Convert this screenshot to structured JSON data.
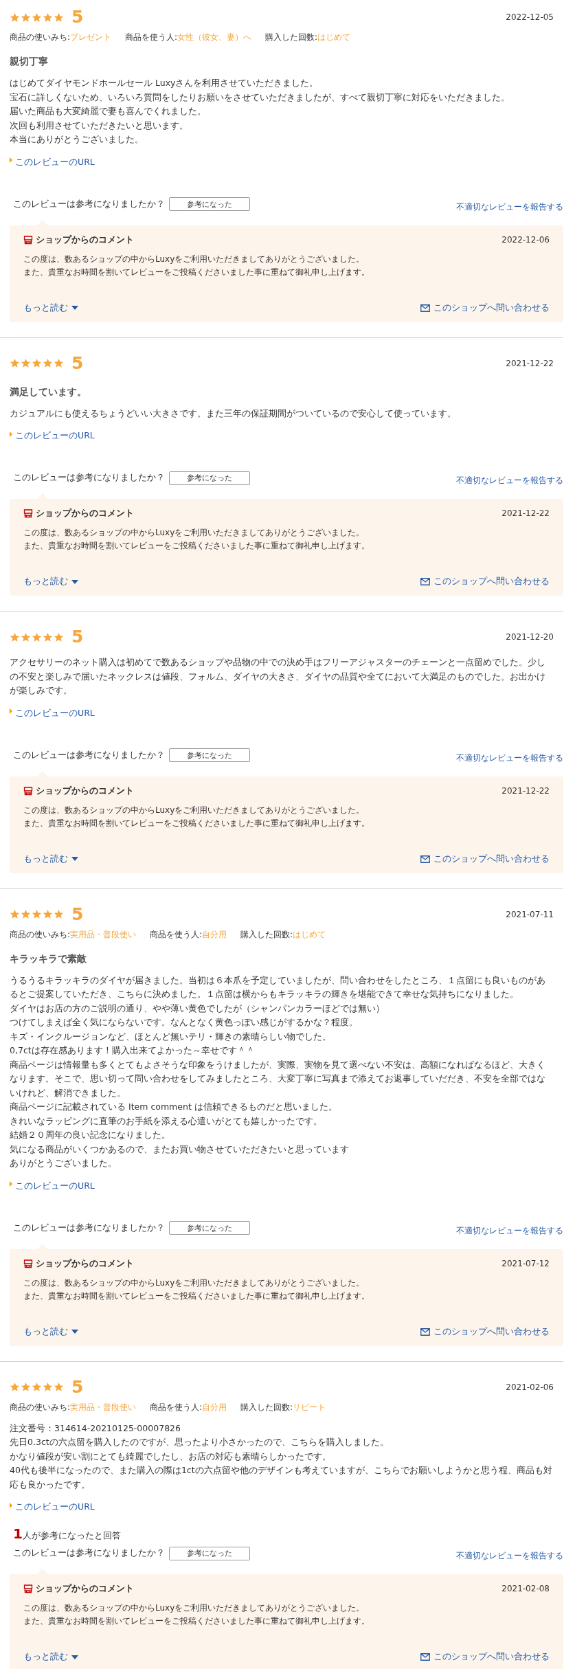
{
  "reviews": [
    {
      "stars": 5,
      "score": "5",
      "date": "2022-12-05",
      "meta": [
        {
          "label": "商品の使いみち:",
          "value": "プレゼント"
        },
        {
          "label": "商品を使う人:",
          "value": "女性（彼女、妻）へ"
        },
        {
          "label": "購入した回数:",
          "value": "はじめて"
        }
      ],
      "title": "親切丁寧",
      "body": [
        "はじめてダイヤモンドホールセール Luxyさんを利用させていただきました。",
        "宝石に詳しくないため、いろいろ質問をしたりお願いをさせていただきましたが、すべて親切丁寧に対応をいただきました。",
        "届いた商品も大変綺麗で妻も喜んでくれました。",
        "次回も利用させていただきたいと思います。",
        "本当にありがとうございました。"
      ],
      "url_link": "このレビューのURL",
      "question": "このレビューは参考になりましたか？",
      "helpful_button": "参考になった",
      "report_link": "不適切なレビューを報告する",
      "shop_comment": {
        "title": "ショップからのコメント",
        "date": "2022-12-06",
        "lines": [
          "この度は、数あるショップの中からLuxyをご利用いただきましてありがとうございました。",
          "また、貴重なお時間を割いてレビューをご投稿くださいました事に重ねて御礼申し上げます。"
        ],
        "more_link": "もっと読む",
        "contact_link": "このショップへ問い合わせる"
      }
    },
    {
      "stars": 5,
      "score": "5",
      "date": "2021-12-22",
      "title": "満足しています。",
      "body": [
        "カジュアルにも使えるちょうどいい大きさです。また三年の保証期間がついているので安心して使っています。"
      ],
      "url_link": "このレビューのURL",
      "question": "このレビューは参考になりましたか？",
      "helpful_button": "参考になった",
      "report_link": "不適切なレビューを報告する",
      "shop_comment": {
        "title": "ショップからのコメント",
        "date": "2021-12-22",
        "lines": [
          "この度は、数あるショップの中からLuxyをご利用いただきましてありがとうございました。",
          "また、貴重なお時間を割いてレビューをご投稿くださいました事に重ねて御礼申し上げます。"
        ],
        "more_link": "もっと読む",
        "contact_link": "このショップへ問い合わせる"
      }
    },
    {
      "stars": 5,
      "score": "5",
      "date": "2021-12-20",
      "body": [
        "アクセサリーのネット購入は初めてで数あるショップや品物の中での決め手はフリーアジャスターのチェーンと一点留めでした。少しの不安と楽しみで届いたネックレスは値段、フォルム、ダイヤの大きさ、ダイヤの品質や全てにおいて大満足のものでした。お出かけが楽しみです。"
      ],
      "url_link": "このレビューのURL",
      "question": "このレビューは参考になりましたか？",
      "helpful_button": "参考になった",
      "report_link": "不適切なレビューを報告する",
      "shop_comment": {
        "title": "ショップからのコメント",
        "date": "2021-12-22",
        "lines": [
          "この度は、数あるショップの中からLuxyをご利用いただきましてありがとうございました。",
          "また、貴重なお時間を割いてレビューをご投稿くださいました事に重ねて御礼申し上げます。"
        ],
        "more_link": "もっと読む",
        "contact_link": "このショップへ問い合わせる"
      }
    },
    {
      "stars": 5,
      "score": "5",
      "date": "2021-07-11",
      "meta": [
        {
          "label": "商品の使いみち:",
          "value": "実用品・普段使い"
        },
        {
          "label": "商品を使う人:",
          "value": "自分用"
        },
        {
          "label": "購入した回数:",
          "value": "はじめて"
        }
      ],
      "title": "キラッキラで素敵",
      "body": [
        "うるうるキラッキラのダイヤが届きました。当初は６本爪を予定していましたが、問い合わせをしたところ、１点留にも良いものがあるとご提案していただき、こちらに決めました。１点留は横からもキラッキラの輝きを堪能できて幸せな気持ちになりました。",
        "ダイヤはお店の方のご説明の通り、やや薄い黄色でしたが（シャンパンカラーほどでは無い）",
        "つけてしまえば全く気にならないです。なんとなく黄色っぽい感じがするかな？程度。",
        "キズ・インクルージョンなど、ほとんど無いテリ・輝きの素晴らしい物でした。",
        "0,7ctは存在感あります！購入出来てよかった～幸せです＾＾",
        "商品ページは情報量も多くとてもよさそうな印象をうけましたが、実際、実物を見て選べない不安は、高額になればなるほど、大きくなります。そこで、思い切って問い合わせをしてみましたところ、大変丁寧に写真まで添えてお返事していだだき、不安を全部ではないけれど、解消できました。",
        "商品ページに記載されている Item comment は信頼できるものだと思いました。",
        "きれいなラッピングに直筆のお手紙を添える心遣いがとても嬉しかったです。",
        "結婚２０周年の良い記念になりました。",
        "気になる商品がいくつかあるので、またお買い物させていただきたいと思っています",
        "ありがとうございました。"
      ],
      "url_link": "このレビューのURL",
      "question": "このレビューは参考になりましたか？",
      "helpful_button": "参考になった",
      "report_link": "不適切なレビューを報告する",
      "shop_comment": {
        "title": "ショップからのコメント",
        "date": "2021-07-12",
        "lines": [
          "この度は、数あるショップの中からLuxyをご利用いただきましてありがとうございました。",
          "また、貴重なお時間を割いてレビューをご投稿くださいました事に重ねて御礼申し上げます。"
        ],
        "more_link": "もっと読む",
        "contact_link": "このショップへ問い合わせる"
      }
    },
    {
      "stars": 5,
      "score": "5",
      "date": "2021-02-06",
      "meta": [
        {
          "label": "商品の使いみち:",
          "value": "実用品・普段使い"
        },
        {
          "label": "商品を使う人:",
          "value": "自分用"
        },
        {
          "label": "購入した回数:",
          "value": "リピート"
        }
      ],
      "body": [
        "注文番号：314614-20210125-00007826",
        "先日0.3ctの六点留を購入したのですが、思ったより小さかったので、こちらを購入しました。",
        "かなり値段が安い割にとても綺麗でしたし、お店の対応も素晴らしかったです。",
        "40代も後半になったので、また購入の際は1ctの六点留や他のデザインも考えていますが、こちらでお願いしようかと思う程、商品も対応も良かったです。"
      ],
      "url_link": "このレビューのURL",
      "helpful_count": "1",
      "helpful_count_text": "人が参考になったと回答",
      "question": "このレビューは参考になりましたか？",
      "helpful_button": "参考になった",
      "report_link": "不適切なレビューを報告する",
      "shop_comment": {
        "title": "ショップからのコメント",
        "date": "2021-02-08",
        "lines": [
          "この度は、数あるショップの中からLuxyをご利用いただきましてありがとうございました。",
          "また、貴重なお時間を割いてレビューをご投稿くださいました事に重ねて御礼申し上げます。"
        ],
        "more_link": "もっと読む",
        "contact_link": "このショップへ問い合わせる"
      }
    }
  ]
}
